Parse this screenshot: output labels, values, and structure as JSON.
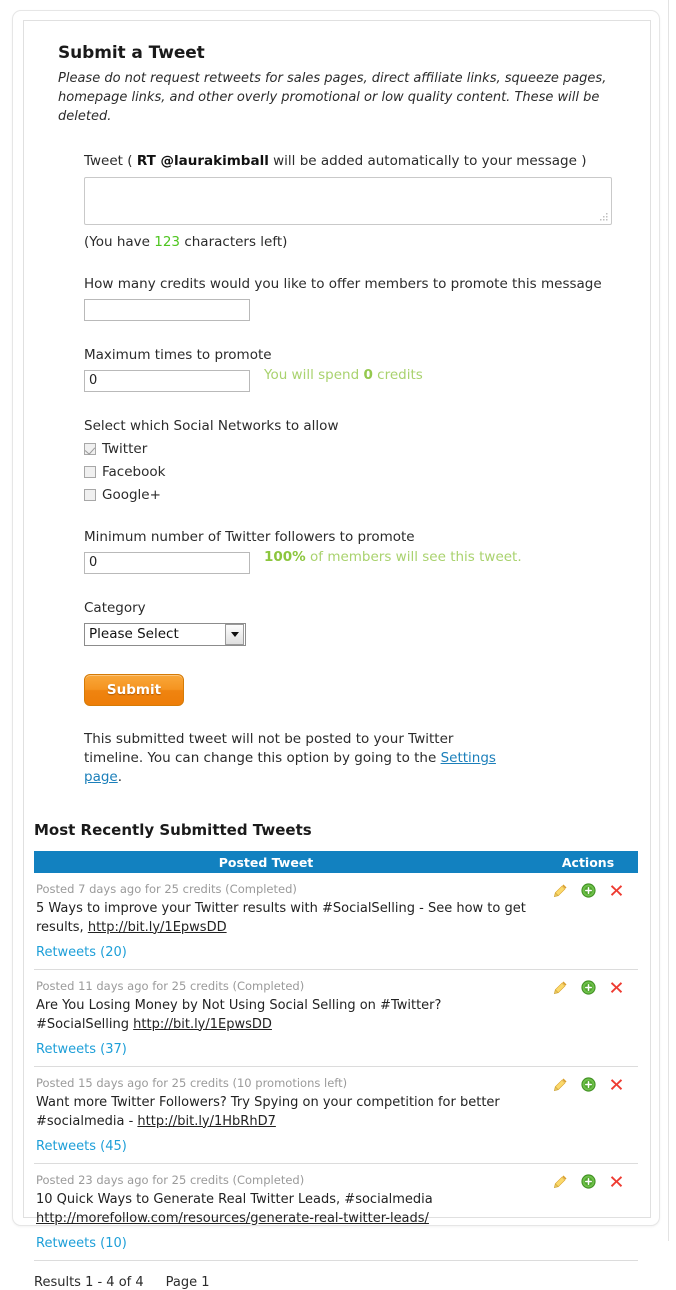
{
  "form": {
    "title": "Submit a Tweet",
    "intro": "Please do not request retweets for sales pages, direct affiliate links, squeeze pages, homepage links, and other overly promotional or low quality content. These will be deleted.",
    "tweet_label_pre": "Tweet ( ",
    "tweet_label_handle": "RT @laurakimball",
    "tweet_label_post": " will be added automatically to your message )",
    "tweet_value": "",
    "chars_pre": "(You have ",
    "chars_count": "123",
    "chars_post": " characters left)",
    "credits_label": "How many credits would you like to offer members to promote this message",
    "credits_value": "",
    "max_promote_label": "Maximum times to promote",
    "max_promote_value": "0",
    "spend_pre": "You will spend ",
    "spend_amount": "0",
    "spend_post": " credits",
    "networks_label": "Select which Social Networks to allow",
    "networks": [
      {
        "label": "Twitter",
        "checked": true
      },
      {
        "label": "Facebook",
        "checked": false
      },
      {
        "label": "Google+",
        "checked": false
      }
    ],
    "followers_label": "Minimum number of Twitter followers to promote",
    "followers_value": "0",
    "reach_percent": "100%",
    "reach_text": " of members will see this tweet.",
    "category_label": "Category",
    "category_selected": "Please Select",
    "submit_label": "Submit",
    "note_pre": "This submitted tweet will not be posted to your Twitter timeline. You can change this option by going to the ",
    "note_link": "Settings page",
    "note_post": "."
  },
  "table": {
    "heading": "Most Recently Submitted Tweets",
    "columns": {
      "tweet": "Posted Tweet",
      "actions": "Actions"
    },
    "rows": [
      {
        "meta": "Posted 7 days ago for 25 credits (Completed)",
        "text": "5 Ways to improve your Twitter results with #SocialSelling - See how to get results, ",
        "link": "http://bit.ly/1EpwsDD",
        "retweets": "Retweets (20)"
      },
      {
        "meta": "Posted 11 days ago for 25 credits (Completed)",
        "text": "Are You Losing Money by Not Using Social Selling on #Twitter? #SocialSelling ",
        "link": "http://bit.ly/1EpwsDD",
        "retweets": "Retweets (37)"
      },
      {
        "meta": "Posted 15 days ago for 25 credits (10 promotions left)",
        "text": "Want more Twitter Followers? Try Spying on your competition for better #socialmedia - ",
        "link": "http://bit.ly/1HbRhD7",
        "retweets": "Retweets (45)"
      },
      {
        "meta": "Posted 23 days ago for 25 credits (Completed)",
        "text": "10 Quick Ways to Generate Real Twitter Leads, #socialmedia ",
        "link": "http://morefollow.com/resources/generate-real-twitter-leads/",
        "retweets": "Retweets (10)"
      }
    ],
    "actions": {
      "edit": "edit-pencil-icon",
      "add": "add-circle-icon",
      "delete": "delete-x-icon"
    },
    "results_text": "Results 1 - 4 of 4",
    "page_text": "Page 1"
  },
  "colors": {
    "header_blue": "#1281c0",
    "link_blue": "#1e9fd8",
    "green": "#a9d26e",
    "char_green": "#4fc520",
    "orange": "#f59420"
  }
}
